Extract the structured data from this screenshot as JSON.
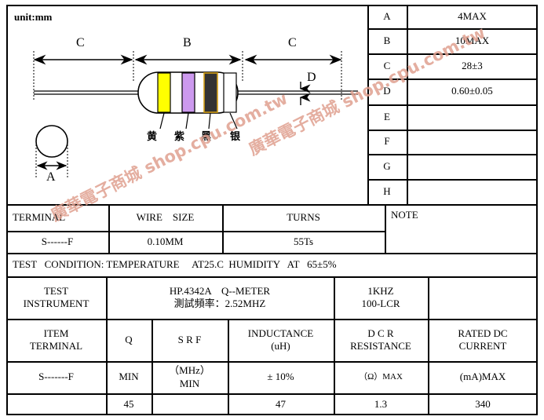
{
  "document": {
    "unit_label": "unit:mm",
    "watermark_text": "廣華電子商城 shop.cpu.com.tw",
    "watermark_color": "#e0a090"
  },
  "drawing": {
    "name": "axial-leaded-inductor-outline",
    "dimension_labels": {
      "left_lead": "C",
      "body": "B",
      "right_lead": "C",
      "lead_diameter": "D",
      "body_diameter": "A"
    },
    "color_bands": [
      {
        "label": "黄",
        "color": "#ffff00",
        "name": "yellow-band"
      },
      {
        "label": "紫",
        "color": "#cc99ee",
        "name": "violet-band"
      },
      {
        "label": "黑",
        "color": "#333333",
        "name": "black-band"
      },
      {
        "label": "银",
        "color": "#ffffff",
        "name": "silver-band"
      }
    ]
  },
  "dimension_table": {
    "rows": [
      {
        "letter": "A",
        "value": "4MAX"
      },
      {
        "letter": "B",
        "value": "10MAX"
      },
      {
        "letter": "C",
        "value": "28±3"
      },
      {
        "letter": "D",
        "value": "0.60±0.05"
      },
      {
        "letter": "E",
        "value": ""
      },
      {
        "letter": "F",
        "value": ""
      },
      {
        "letter": "G",
        "value": ""
      },
      {
        "letter": "H",
        "value": ""
      }
    ]
  },
  "winding_table": {
    "headers": {
      "terminal": "TERMINAL",
      "wire_size": "WIRE    SIZE",
      "turns": "TURNS",
      "note": "NOTE"
    },
    "values": {
      "terminal": "S------F",
      "wire_size": "0.10MM",
      "turns": "55Ts",
      "note": ""
    }
  },
  "test_condition": {
    "text": "TEST   CONDITION: TEMPERATURE     AT25.C  HUMIDITY   AT   65±5%"
  },
  "test_instrument": {
    "label_line1": "TEST",
    "label_line2": "INSTRUMENT",
    "q_meter_line1": "HP.4342A    Q--METER",
    "q_meter_line2": "測試頻率：2.52MHZ",
    "lcr_line1": "1KHZ",
    "lcr_line2": "100-LCR",
    "extra": ""
  },
  "spec_table": {
    "headers": [
      {
        "line1": "ITEM",
        "line2": "TERMINAL"
      },
      {
        "line1": "Q",
        "line2": ""
      },
      {
        "line1": "S R F",
        "line2": ""
      },
      {
        "line1": "INDUCTANCE",
        "line2": "(uH)"
      },
      {
        "line1": "D C R",
        "line2": "RESISTANCE"
      },
      {
        "line1": "RATED DC",
        "line2": "CURRENT"
      }
    ],
    "condition_row": [
      {
        "line1": "S-------F",
        "line2": ""
      },
      {
        "line1": "MIN",
        "line2": ""
      },
      {
        "line1": "（MHz）",
        "line2": "MIN"
      },
      {
        "line1": "± 10%",
        "line2": ""
      },
      {
        "line1": "（Ω）MAX",
        "line2": ""
      },
      {
        "line1": "(mA)MAX",
        "line2": ""
      }
    ],
    "value_row": [
      "",
      "45",
      "",
      "47",
      "1.3",
      "340"
    ]
  }
}
